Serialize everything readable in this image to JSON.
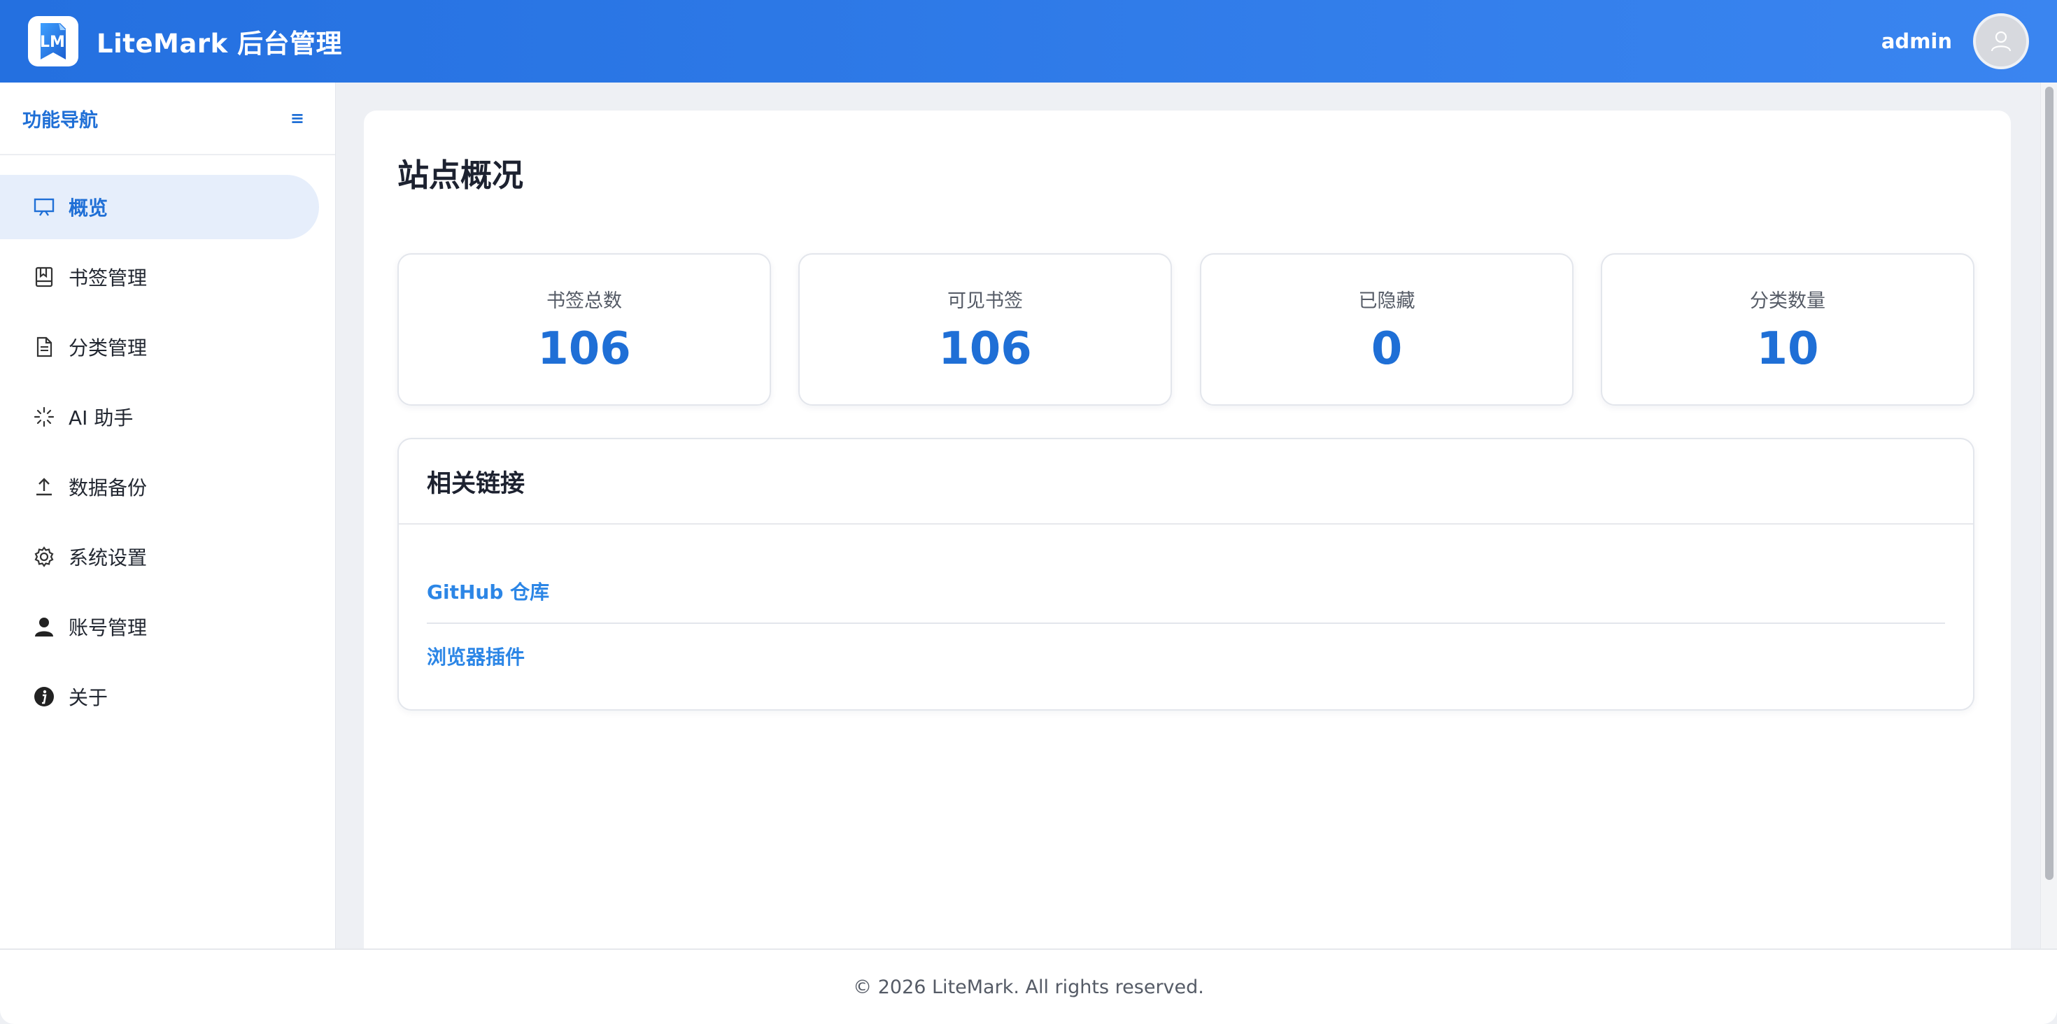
{
  "header": {
    "logo_text": "LM",
    "app_title": "LiteMark 后台管理",
    "username": "admin"
  },
  "sidebar": {
    "title": "功能导航",
    "collapse_symbol": "≡",
    "items": [
      {
        "label": "概览",
        "icon": "monitor-icon",
        "active": true
      },
      {
        "label": "书签管理",
        "icon": "bookmark-icon",
        "active": false
      },
      {
        "label": "分类管理",
        "icon": "document-icon",
        "active": false
      },
      {
        "label": "AI 助手",
        "icon": "sparkle-icon",
        "active": false
      },
      {
        "label": "数据备份",
        "icon": "upload-icon",
        "active": false
      },
      {
        "label": "系统设置",
        "icon": "gear-icon",
        "active": false
      },
      {
        "label": "账号管理",
        "icon": "user-icon",
        "active": false
      },
      {
        "label": "关于",
        "icon": "info-icon",
        "active": false
      }
    ]
  },
  "main": {
    "title": "站点概况",
    "stats": [
      {
        "label": "书签总数",
        "value": "106"
      },
      {
        "label": "可见书签",
        "value": "106"
      },
      {
        "label": "已隐藏",
        "value": "0"
      },
      {
        "label": "分类数量",
        "value": "10"
      }
    ],
    "links_title": "相关链接",
    "links": [
      {
        "label": "GitHub 仓库"
      },
      {
        "label": "浏览器插件"
      }
    ]
  },
  "footer": {
    "text": "© 2026 LiteMark. All rights reserved."
  },
  "colors": {
    "primary": "#1f6fd6",
    "header_gradient_start": "#2470e0",
    "header_gradient_end": "#3a85f0",
    "link": "#2c86e6",
    "active_nav_bg": "#e6eefb"
  }
}
